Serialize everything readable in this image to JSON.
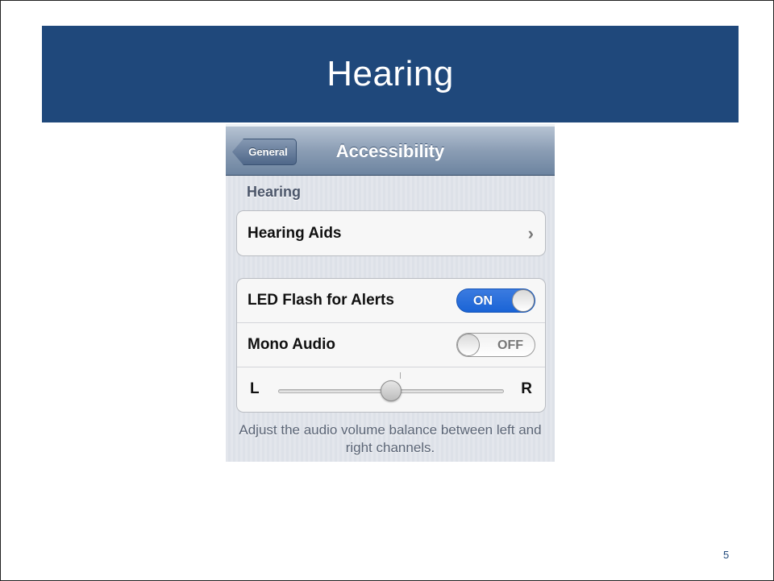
{
  "slide": {
    "title": "Hearing",
    "page_number": "5"
  },
  "ios_screen": {
    "back_button_label": "General",
    "nav_title": "Accessibility",
    "section_header": "Hearing",
    "hearing_aids_row": {
      "label": "Hearing Aids",
      "chevron": "›"
    },
    "led_flash_row": {
      "label": "LED Flash for Alerts",
      "toggle_text": "ON",
      "state": "on"
    },
    "mono_audio_row": {
      "label": "Mono Audio",
      "toggle_text": "OFF",
      "state": "off"
    },
    "balance_row": {
      "left_label": "L",
      "right_label": "R",
      "balance_value": 0.5
    },
    "footer_note": "Adjust the audio volume balance between left and right channels."
  },
  "colors": {
    "banner": "#1f487b",
    "toggle_on": "#1a64d6"
  }
}
